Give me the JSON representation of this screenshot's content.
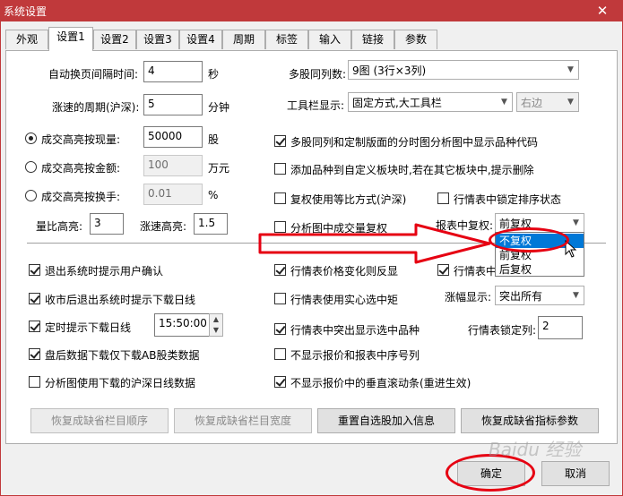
{
  "window": {
    "title": "系统设置",
    "close": "✕"
  },
  "tabs": [
    "外观",
    "设置1",
    "设置2",
    "设置3",
    "设置4",
    "周期",
    "标签",
    "输入",
    "链接",
    "参数"
  ],
  "left": {
    "auto_page_label": "自动换页间隔时间:",
    "auto_page_value": "4",
    "auto_page_unit": "秒",
    "speed_period_label": "涨速的周期(沪深):",
    "speed_period_value": "5",
    "speed_period_unit": "分钟",
    "hl_volume_label": "成交高亮按现量:",
    "hl_volume_value": "50000",
    "hl_volume_unit": "股",
    "hl_amount_label": "成交高亮按金额:",
    "hl_amount_value": "100",
    "hl_amount_unit": "万元",
    "hl_turnover_label": "成交高亮按换手:",
    "hl_turnover_value": "0.01",
    "hl_turnover_unit": "%",
    "vol_ratio_label": "量比高亮:",
    "vol_ratio_value": "3",
    "speed_hl_label": "涨速高亮:",
    "speed_hl_value": "1.5"
  },
  "right": {
    "multi_cols_label": "多股同列数:",
    "multi_cols_value": "9图 (3行×3列)",
    "toolbar_label": "工具栏显示:",
    "toolbar_value": "固定方式,大工具栏",
    "toolbar_pos": "右边",
    "cb_show_code": "多股同列和定制版面的分时图分析图中显示品种代码",
    "cb_prompt_delete": "添加品种到自定义板块时,若在其它板块中,提示删除",
    "cb_equal_ratio": "复权使用等比方式(沪深)",
    "cb_lock_sort": "行情表中锁定排序状态",
    "cb_volume_adjust": "分析图中成交量复权",
    "adjust_label": "报表中复权:",
    "adjust_value": "前复权",
    "adjust_options": [
      "不复权",
      "前复权",
      "后复权"
    ]
  },
  "lower_left": {
    "cb_exit_confirm": "退出系统时提示用户确认",
    "cb_close_download": "收市后退出系统时提示下载日线",
    "cb_timed_download": "定时提示下载日线",
    "timed_value": "15:50:00",
    "cb_ab_only": "盘后数据下载仅下载AB股类数据",
    "cb_downloaded_daily": "分析图使用下载的沪深日线数据"
  },
  "lower_right": {
    "cb_price_change": "行情表价格变化则反显",
    "cb_hidden_partial": "行情表中",
    "cb_solid_box": "行情表使用实心选中矩",
    "rise_label": "涨幅显示:",
    "rise_value": "突出所有",
    "cb_highlight_selected": "行情表中突出显示选中品种",
    "lock_cols_label": "行情表锁定列:",
    "lock_cols_value": "2",
    "cb_no_seq": "不显示报价和报表中序号列",
    "cb_no_scroll": "不显示报价中的垂直滚动条(重进生效)"
  },
  "buttons": {
    "restore_order": "恢复成缺省栏目顺序",
    "restore_width": "恢复成缺省栏目宽度",
    "reset_self_stock": "重置自选股加入信息",
    "restore_indicator": "恢复成缺省指标参数",
    "ok": "确定",
    "cancel": "取消"
  },
  "watermark": "Baidu 经验",
  "colors": {
    "title_bar": "#c0393b",
    "annotation": "#e60012",
    "selection": "#0078d7"
  }
}
